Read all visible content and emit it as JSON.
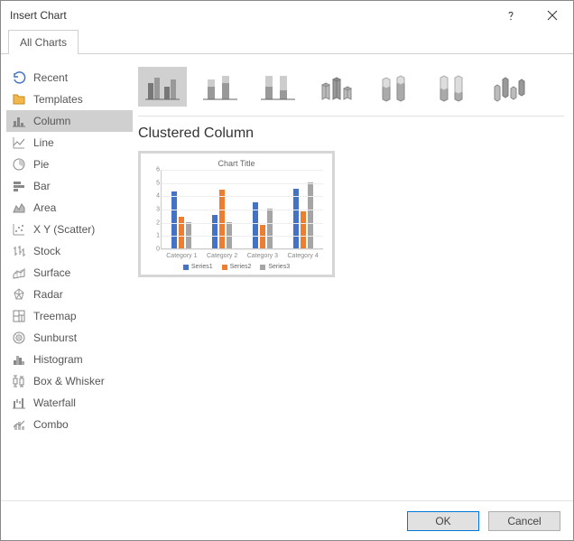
{
  "title": "Insert Chart",
  "tab_label": "All Charts",
  "sidebar": {
    "items": [
      "Recent",
      "Templates",
      "Column",
      "Line",
      "Pie",
      "Bar",
      "Area",
      "X Y (Scatter)",
      "Stock",
      "Surface",
      "Radar",
      "Treemap",
      "Sunburst",
      "Histogram",
      "Box & Whisker",
      "Waterfall",
      "Combo"
    ]
  },
  "preview_heading": "Clustered Column",
  "buttons": {
    "ok": "OK",
    "cancel": "Cancel"
  },
  "chart_data": {
    "type": "bar",
    "title": "Chart Title",
    "categories": [
      "Category 1",
      "Category 2",
      "Category 3",
      "Category 4"
    ],
    "series": [
      {
        "name": "Series1",
        "values": [
          4.3,
          2.5,
          3.5,
          4.5
        ],
        "color": "#4472c4"
      },
      {
        "name": "Series2",
        "values": [
          2.4,
          4.4,
          1.8,
          2.8
        ],
        "color": "#ed7d31"
      },
      {
        "name": "Series3",
        "values": [
          2.0,
          2.0,
          3.0,
          5.0
        ],
        "color": "#a5a5a5"
      }
    ],
    "ylim": [
      0,
      6
    ],
    "yticks": [
      0,
      1,
      2,
      3,
      4,
      5,
      6
    ]
  }
}
